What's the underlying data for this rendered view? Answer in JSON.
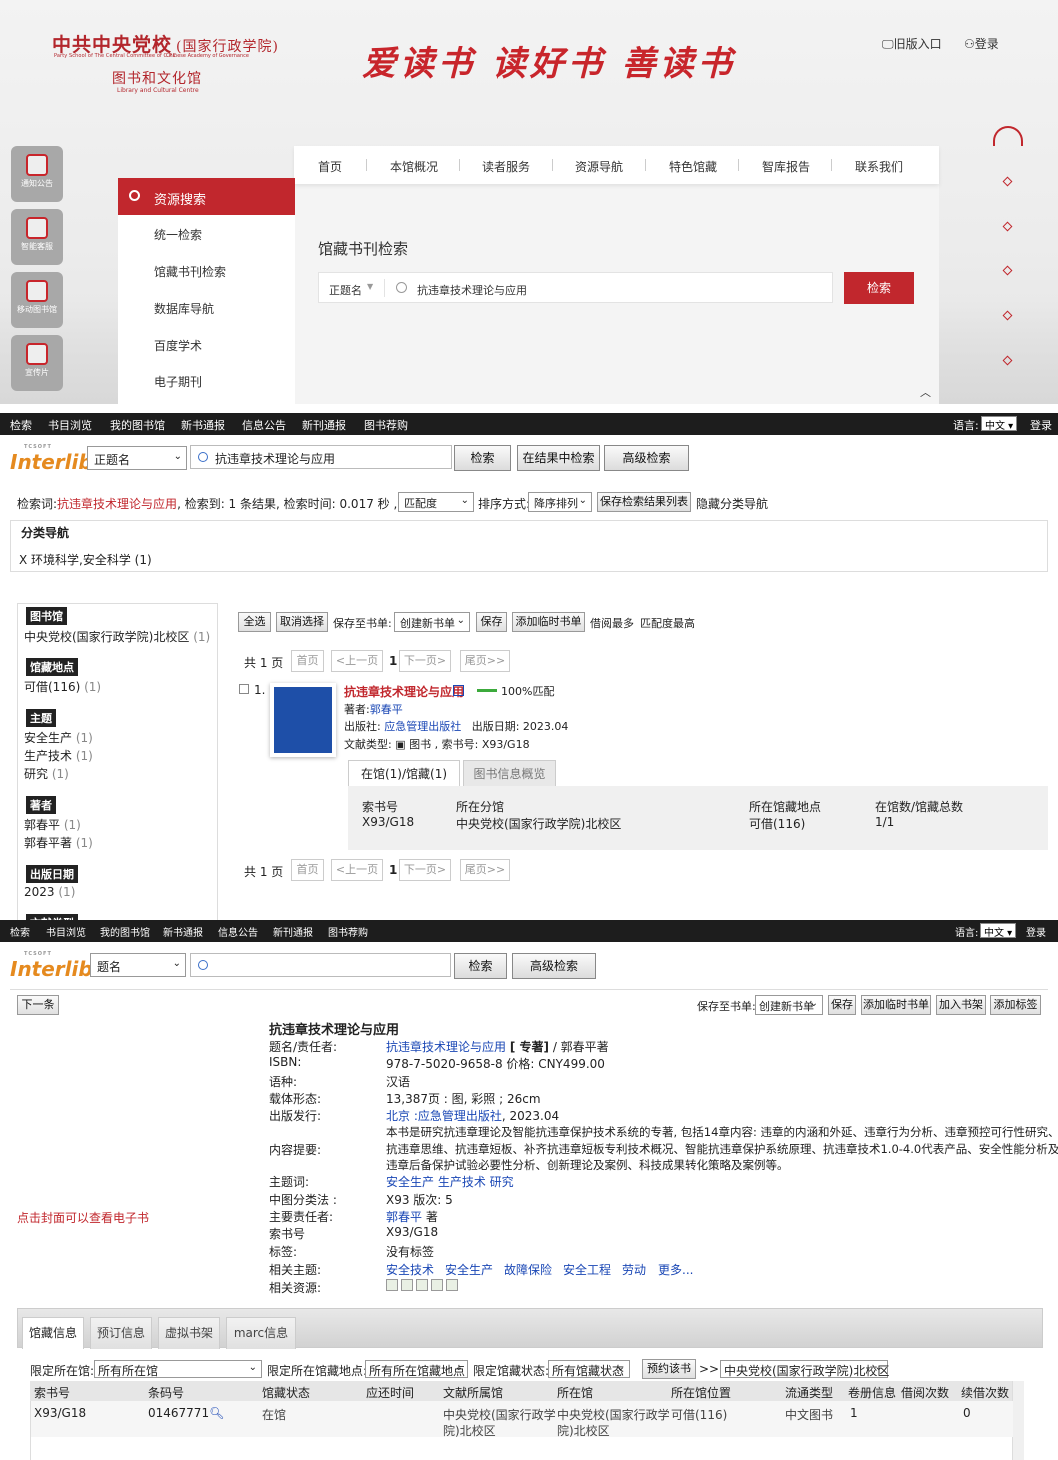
{
  "portal": {
    "logo_cn": "中共中央党校",
    "logo_cn2": "(国家行政学院)",
    "logo_en1": "Party School of The Central Committee of C.P.C",
    "logo_en2": "Chinese Academy of Governance",
    "logo_sub": "图书和文化馆",
    "logo_sub_en": "Library and Cultural Centre",
    "slogan": "爱读书 读好书 善读书",
    "old_entry": "旧版入口",
    "login": "登录",
    "side": [
      "通知公告",
      "智能客服",
      "移动图书馆",
      "宣传片"
    ],
    "nav": [
      "首页",
      "本馆概况",
      "读者服务",
      "资源导航",
      "特色馆藏",
      "智库报告",
      "联系我们"
    ],
    "menu_head": "资源搜索",
    "menu": [
      "统一检索",
      "馆藏书刊检索",
      "数据库导航",
      "百度学术",
      "电子期刊"
    ],
    "panel_title": "馆藏书刊检索",
    "field": "正题名",
    "query": "抗违章技术理论与应用",
    "search_btn": "检索",
    "accent": "#c1272d"
  },
  "topbar": {
    "items": [
      "检索",
      "书目浏览",
      "我的图书馆",
      "新书通报",
      "信息公告",
      "新刊通报",
      "图书荐购"
    ],
    "lang_label": "语言:",
    "lang_value": "中文",
    "login": "登录"
  },
  "interlib": {
    "logo": "Interlib",
    "brand": "TCSOFT"
  },
  "results": {
    "field": "正题名",
    "query": "抗违章技术理论与应用",
    "btn_search": "检索",
    "btn_in_results": "在结果中检索",
    "btn_advanced": "高级检索",
    "summary_prefix": "检索词:",
    "summary_term": "抗违章技术理论与应用",
    "summary_rest": ", 检索到: 1 条结果, 检索时间: 0.017 秒 , 排序选项:",
    "sort_option": "匹配度",
    "sort_label": "排序方式:",
    "sort_dir": "降序排列",
    "save_list": "保存检索结果列表",
    "hide_nav": "隐藏分类导航",
    "cat_nav": "分类导航",
    "cat_item": "X 环境科学,安全科学 (1)",
    "facets": {
      "library": {
        "title": "图书馆",
        "items": [
          {
            "name": "中央党校(国家行政学院)北校区",
            "count": "(1)"
          }
        ]
      },
      "location": {
        "title": "馆藏地点",
        "items": [
          {
            "name": "可借(116)",
            "count": "(1)"
          }
        ]
      },
      "subject": {
        "title": "主题",
        "items": [
          {
            "name": "安全生产",
            "count": "(1)"
          },
          {
            "name": "生产技术",
            "count": "(1)"
          },
          {
            "name": "研究",
            "count": "(1)"
          }
        ]
      },
      "author": {
        "title": "著者",
        "items": [
          {
            "name": "郭春平",
            "count": "(1)"
          },
          {
            "name": "郭春平著",
            "count": "(1)"
          }
        ]
      },
      "date": {
        "title": "出版日期",
        "items": [
          {
            "name": "2023",
            "count": "(1)"
          }
        ]
      },
      "doctype": {
        "title": "文献类型"
      }
    },
    "actions": {
      "select_all": "全选",
      "unselect": "取消选择",
      "save_to": "保存至书单:",
      "new_list": "创建新书单",
      "save": "保存",
      "add_temp": "添加临时书单",
      "most_borrowed": "借阅最多",
      "best_match": "匹配度最高"
    },
    "pager": {
      "total": "共 1 页",
      "first": "首页",
      "prev": "<上一页",
      "current": "1",
      "next": "下一页>",
      "last": "尾页>>"
    },
    "item": {
      "index": "1.",
      "title": "抗违章技术理论与应用",
      "match": "100%匹配",
      "author_label": "著者:",
      "author": "郭春平",
      "publisher_label": "出版社:",
      "publisher": "应急管理出版社",
      "pubdate": "出版日期: 2023.04",
      "doctype_label": "文献类型:",
      "doctype": "图书 , 索书号: X93/G18",
      "tab_holdings": "在馆(1)/馆藏(1)",
      "tab_overview": "图书信息概览",
      "cols": [
        "索书号",
        "所在分馆",
        "所在馆藏地点",
        "在馆数/馆藏总数"
      ],
      "row": [
        "X93/G18",
        "中央党校(国家行政学院)北校区",
        "可借(116)",
        "1/1"
      ]
    }
  },
  "detail": {
    "field": "题名",
    "btn_search": "检索",
    "btn_advanced": "高级检索",
    "next": "下一条",
    "save_to": "保存至书单:",
    "new_list": "创建新书单",
    "save": "保存",
    "add_temp": "添加临时书单",
    "add_shelf": "加入书架",
    "add_tag": "添加标签",
    "cover_hint": "点击封面可以查看电子书",
    "title": "抗违章技术理论与应用",
    "fields": {
      "title_resp_label": "题名/责任者:",
      "title_link": "抗违章技术理论与应用",
      "title_mid": "[ 专著]",
      "title_tail": "/ 郭春平著",
      "isbn_label": "ISBN:",
      "isbn": "978-7-5020-9658-8 价格: CNY499.00",
      "lang_label": "语种:",
      "lang": "汉语",
      "form_label": "载体形态:",
      "form": "13,387页 : 图, 彩照 ; 26cm",
      "pub_label": "出版发行:",
      "pub_place": "北京 :",
      "pub_name": "应急管理出版社",
      "pub_year": ", 2023.04",
      "abstract_label": "内容提要:",
      "abstract_lines": [
        "本书是研究抗违章理论及智能抗违章保护技术系统的专著, 包括14章内容: 违章的内涵和外延、违章行为分析、违章预控可行性研究、",
        "抗违章思维、抗违章短板、补齐抗违章短板专利技术概况、智能抗违章保护系统原理、抗违章技术1.0-4.0代表产品、安全性能分析及抗",
        "违章后备保护试验必要性分析、创新理论及案例、科技成果转化策略及案例等。"
      ],
      "subject_label": "主题词:",
      "subjects": "安全生产 生产技术 研究",
      "clc_label": "中图分类法 :",
      "clc": "X93 版次:  5",
      "resp_label": "主要责任者:",
      "resp_link": "郭春平",
      "resp_tail": "著",
      "callno_label": "索书号",
      "callno": "X93/G18",
      "tag_label": "标签:",
      "tag": "没有标签",
      "related_label": "相关主题:",
      "related": [
        "安全技术",
        "安全生产",
        "故障保险",
        "安全工程",
        "劳动",
        "更多..."
      ],
      "resources_label": "相关资源:"
    },
    "tabs": [
      "馆藏信息",
      "预订信息",
      "虚拟书架",
      "marc信息"
    ],
    "filters": {
      "place_label": "限定所在馆:",
      "place": "所有所在馆",
      "loc_label": "限定所在馆藏地点:",
      "loc": "所有所在馆藏地点",
      "state_label": "限定馆藏状态:",
      "state": "所有馆藏状态",
      "reserve": "预约该书",
      "arrow": ">>",
      "branch": "中央党校(国家行政学院)北校区"
    },
    "table": {
      "cols": [
        "索书号",
        "条码号",
        "馆藏状态",
        "应还时间",
        "文献所属馆",
        "所在馆",
        "所在馆位置",
        "流通类型",
        "卷册信息",
        "借阅次数",
        "续借次数"
      ],
      "row": {
        "callno": "X93/G18",
        "barcode": "01467771",
        "state": "在馆",
        "due": "",
        "owner1": "中央党校(国家行政学",
        "owner2": "院)北校区",
        "at1": "中央党校(国家行政学",
        "at2": "院)北校区",
        "pos": "可借(116)",
        "type": "中文图书",
        "vol": "1",
        "borrows": "",
        "renews": "0"
      }
    }
  }
}
